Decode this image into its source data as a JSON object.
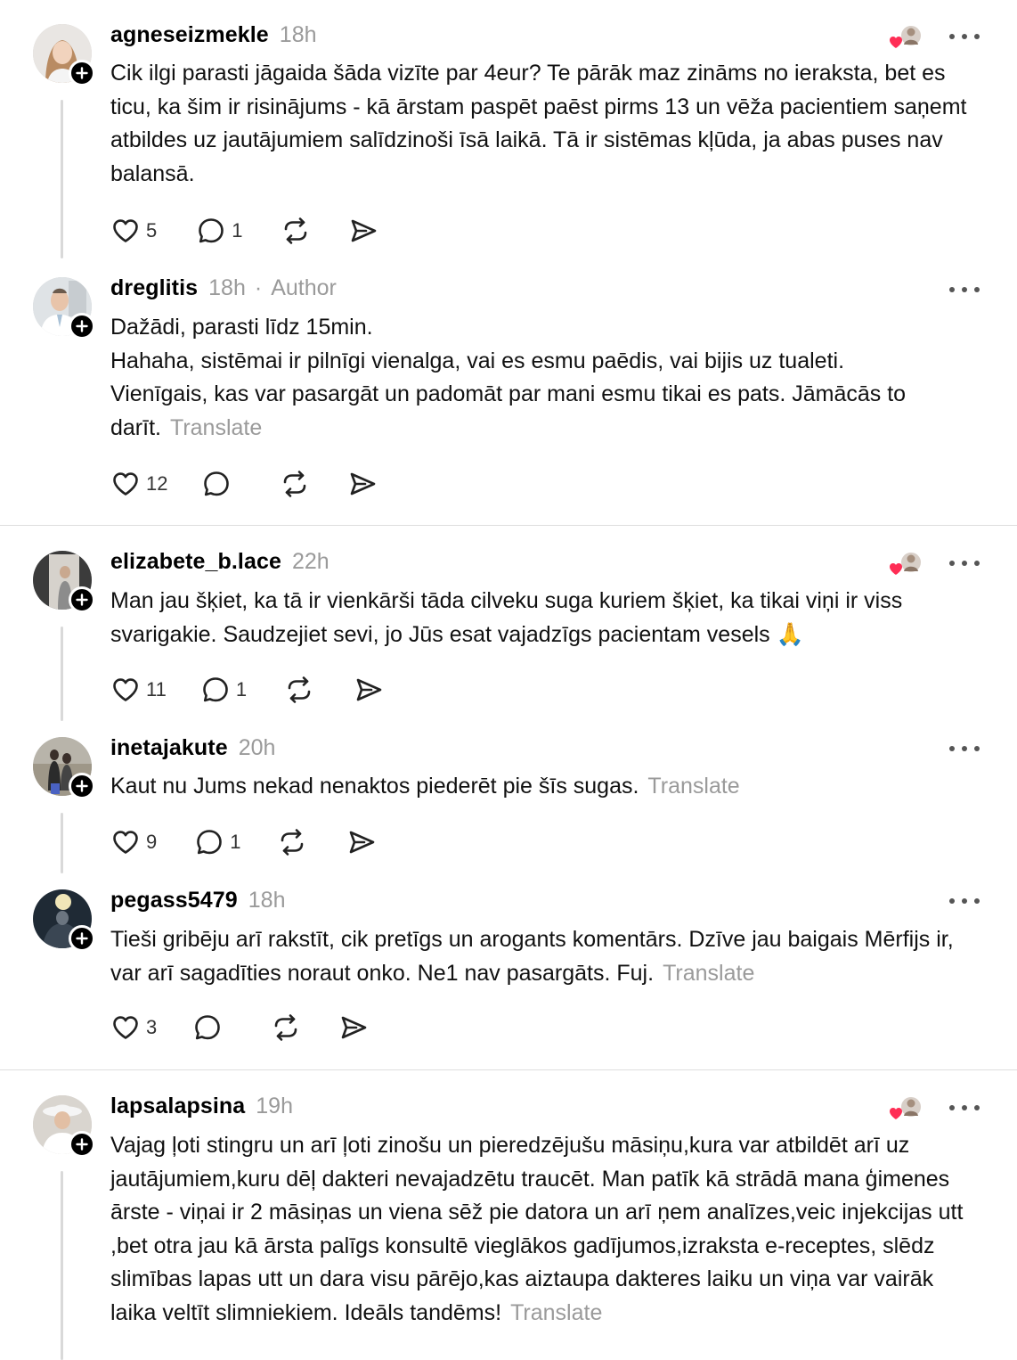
{
  "posts": [
    {
      "username": "agneseizmekle",
      "time": "18h",
      "text": "Cik ilgi parasti jāgaida šāda vizīte par 4eur? Te pārāk maz zināms no ieraksta, bet es ticu, ka šim ir risinājums - kā ārstam paspēt paēst pirms 13 un vēža pacientiem saņemt atbildes uz jautājumiem salīdzinoši īsā laikā. Tā ir sistēmas kļūda, ja abas puses nav balansā.",
      "likes": "5",
      "replies": "1",
      "avatar_icon": "avatar-woman-blonde"
    },
    {
      "username": "dreglitis",
      "time": "18h",
      "author_label": "Author",
      "text": "Dažādi, parasti līdz 15min.\nHahaha, sistēmai ir pilnīgi vienalga, vai es esmu paēdis, vai bijis uz tualeti.\nVienīgais, kas var pasargāt un padomāt par mani esmu tikai es pats. Jāmācās to darīt.",
      "translate": "Translate",
      "likes": "12",
      "replies": "",
      "avatar_icon": "avatar-doctor"
    },
    {
      "username": "elizabete_b.lace",
      "time": "22h",
      "text": "Man jau šķiet, ka tā ir vienkārši tāda cilveku suga kuriem šķiet, ka tikai viņi ir viss svarigakie. Saudzejiet sevi, jo Jūs esat vajadzīgs pacientam vesels 🙏",
      "likes": "11",
      "replies": "1",
      "avatar_icon": "avatar-mirror-selfie"
    },
    {
      "username": "inetajakute",
      "time": "20h",
      "text": "Kaut nu Jums nekad nenaktos piederēt pie šīs sugas.",
      "translate": "Translate",
      "likes": "9",
      "replies": "1",
      "avatar_icon": "avatar-beach-couple"
    },
    {
      "username": "pegass5479",
      "time": "18h",
      "text": "Tieši gribēju arī rakstīt, cik pretīgs un arogants komentārs. Dzīve jau baigais Mērfijs ir, var arī sagadīties noraut onko. Ne1 nav pasargāts. Fuj.",
      "translate": "Translate",
      "likes": "3",
      "replies": "",
      "avatar_icon": "avatar-night-moon"
    },
    {
      "username": "lapsalapsina",
      "time": "19h",
      "text": "Vajag ļoti stingru un arī ļoti zinošu un pieredzējušu māsiņu,kura var atbildēt arī uz jautājumiem,kuru dēļ dakteri nevajadzētu traucēt. Man patīk kā strādā mana ģimenes ārste - viņai ir 2 māsiņas un viena sēž pie datora un arī ņem analīzes,veic injekcijas utt ,bet otra jau kā ārsta palīgs konsultē vieglākos gadījumos,izraksta e-receptes, slēdz slimības lapas utt un dara visu pārējo,kas aiztaupa dakteres laiku un viņa var vairāk laika veltīt slimniekiem. Ideāls tandēms!",
      "translate": "Translate",
      "likes": "",
      "replies": "",
      "avatar_icon": "avatar-woman-white-hat"
    }
  ],
  "colors": {
    "heart_red": "#ff2d55",
    "muted_text": "#9a9a9a",
    "thread_line": "#d9d9d9"
  }
}
